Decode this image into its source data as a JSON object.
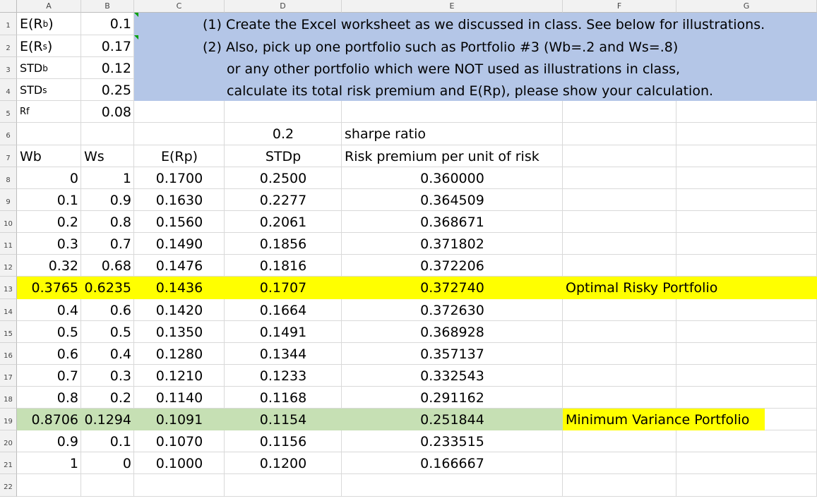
{
  "columns": [
    "A",
    "B",
    "C",
    "D",
    "E",
    "F",
    "G"
  ],
  "rows": [
    "1",
    "2",
    "3",
    "4",
    "5",
    "6",
    "7",
    "8",
    "9",
    "10",
    "11",
    "12",
    "13",
    "14",
    "15",
    "16",
    "17",
    "18",
    "19",
    "20",
    "21",
    "22"
  ],
  "inputs": [
    {
      "label_main": "E(R",
      "label_sub": "b",
      "label_end": ")",
      "value": "0.1"
    },
    {
      "label_main": "E(R",
      "label_sub": "s",
      "label_end": ")",
      "value": "0.17"
    },
    {
      "label_main": "STD",
      "label_sub": "b",
      "label_end": "",
      "value": "0.12"
    },
    {
      "label_main": "STD",
      "label_sub": "s",
      "label_end": "",
      "value": "0.25"
    },
    {
      "label_main": "Rf",
      "label_sub": "",
      "label_end": "",
      "value": "0.08"
    }
  ],
  "notes": [
    "(1) Create the Excel worksheet as we discussed in class. See below for illustrations.",
    "(2) Also, pick up one portfolio such as Portfolio #3 (Wb=.2 and Ws=.8)",
    "or any other portfolio which were NOT used as illustrations in class,",
    "calculate its total risk premium and E(Rp), please show your calculation."
  ],
  "row6": {
    "d": "0.2",
    "e": "sharpe ratio"
  },
  "headers": {
    "wb": "Wb",
    "ws": "Ws",
    "erp": "E(Rp)",
    "stdp": "STDp",
    "rp": "Risk premium per unit of risk"
  },
  "table": [
    {
      "wb": "0",
      "ws": "1",
      "erp": "0.1700",
      "stdp": "0.2500",
      "sr": "0.360000",
      "label": ""
    },
    {
      "wb": "0.1",
      "ws": "0.9",
      "erp": "0.1630",
      "stdp": "0.2277",
      "sr": "0.364509",
      "label": ""
    },
    {
      "wb": "0.2",
      "ws": "0.8",
      "erp": "0.1560",
      "stdp": "0.2061",
      "sr": "0.368671",
      "label": ""
    },
    {
      "wb": "0.3",
      "ws": "0.7",
      "erp": "0.1490",
      "stdp": "0.1856",
      "sr": "0.371802",
      "label": ""
    },
    {
      "wb": "0.32",
      "ws": "0.68",
      "erp": "0.1476",
      "stdp": "0.1816",
      "sr": "0.372206",
      "label": ""
    },
    {
      "wb": "0.3765",
      "ws": "0.6235",
      "erp": "0.1436",
      "stdp": "0.1707",
      "sr": "0.372740",
      "label": "Optimal Risky Portfolio"
    },
    {
      "wb": "0.4",
      "ws": "0.6",
      "erp": "0.1420",
      "stdp": "0.1664",
      "sr": "0.372630",
      "label": ""
    },
    {
      "wb": "0.5",
      "ws": "0.5",
      "erp": "0.1350",
      "stdp": "0.1491",
      "sr": "0.368928",
      "label": ""
    },
    {
      "wb": "0.6",
      "ws": "0.4",
      "erp": "0.1280",
      "stdp": "0.1344",
      "sr": "0.357137",
      "label": ""
    },
    {
      "wb": "0.7",
      "ws": "0.3",
      "erp": "0.1210",
      "stdp": "0.1233",
      "sr": "0.332543",
      "label": ""
    },
    {
      "wb": "0.8",
      "ws": "0.2",
      "erp": "0.1140",
      "stdp": "0.1168",
      "sr": "0.291162",
      "label": ""
    },
    {
      "wb": "0.8706",
      "ws": "0.1294",
      "erp": "0.1091",
      "stdp": "0.1154",
      "sr": "0.251844",
      "label": "Minimum Variance Portfolio"
    },
    {
      "wb": "0.9",
      "ws": "0.1",
      "erp": "0.1070",
      "stdp": "0.1156",
      "sr": "0.233515",
      "label": ""
    },
    {
      "wb": "1",
      "ws": "0",
      "erp": "0.1000",
      "stdp": "0.1200",
      "sr": "0.166667",
      "label": ""
    }
  ],
  "colors": {
    "note_bg": "#b4c6e7",
    "optimal_highlight": "#ffff00",
    "minvar_highlight": "#c6e0b4"
  }
}
